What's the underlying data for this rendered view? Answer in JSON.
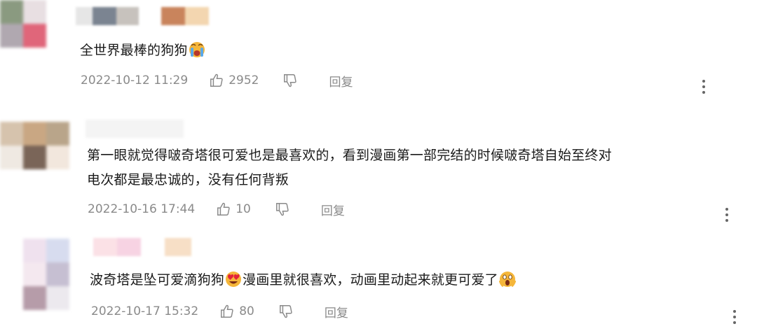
{
  "comments": [
    {
      "text": "全世界最棒的狗狗",
      "emoji": "crying-face-emoji",
      "date": "2022-10-12 11:29",
      "likes": "2952",
      "reply_label": "回复"
    },
    {
      "text_line1": "第一眼就觉得啵奇塔很可爱也是最喜欢的，看到漫画第一部完结的时候啵奇塔自始至终对",
      "text_line2": "电次都是最忠诚的，没有任何背叛",
      "date": "2022-10-16 17:44",
      "likes": "10",
      "reply_label": "回复"
    },
    {
      "text_part1": "波奇塔是坠可爱滴狗狗",
      "emoji1": "heart-eyes-emoji",
      "text_part2": "漫画里就很喜欢，动画里动起来就更可爱了",
      "emoji2": "screaming-face-emoji",
      "date": "2022-10-17 15:32",
      "likes": "80",
      "reply_label": "回复"
    }
  ],
  "colors": {
    "meta_text": "#8a8a8a",
    "comment_text": "#1a1a1a",
    "background": "#ffffff"
  }
}
